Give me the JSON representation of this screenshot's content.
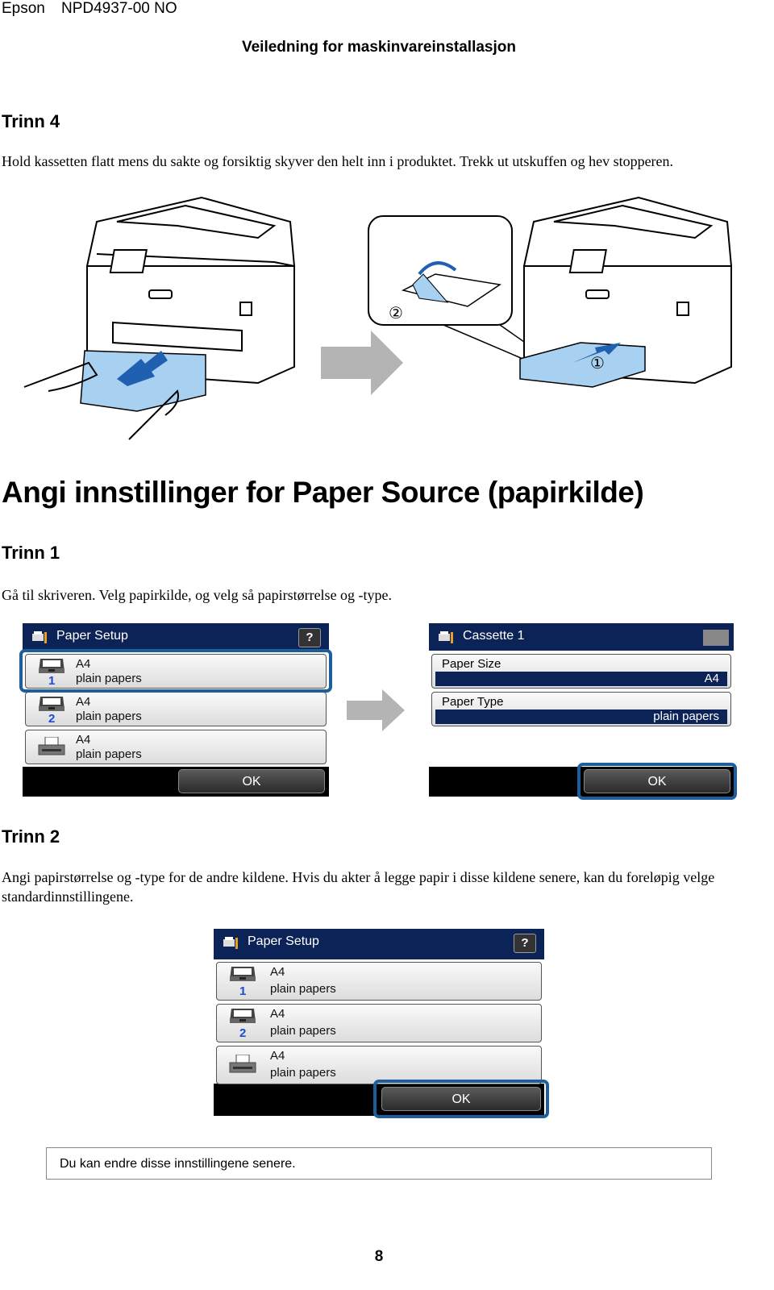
{
  "header": {
    "brand": "Epson",
    "doc_code": "NPD4937-00 NO",
    "title": "Veiledning for maskinvareinstallasjon"
  },
  "step4": {
    "heading": "Trinn 4",
    "text": "Hold kassetten flatt mens du sakte og forsiktig skyver den helt inn i produktet. Trekk ut utskuffen og hev stopperen.",
    "callouts": [
      "①",
      "②"
    ]
  },
  "section": {
    "title": "Angi innstillinger for Paper Source (papirkilde)"
  },
  "step1": {
    "heading": "Trinn 1",
    "text": "Gå til skriveren. Velg papirkilde, og velg så papirstørrelse og -type.",
    "paper_setup_panel": {
      "title": "Paper Setup",
      "help_label": "?",
      "sources": [
        {
          "number": "1",
          "size": "A4",
          "type": "plain papers",
          "selected": true
        },
        {
          "number": "2",
          "size": "A4",
          "type": "plain papers",
          "selected": false
        },
        {
          "number": "",
          "size": "A4",
          "type": "plain papers",
          "selected": false
        }
      ],
      "ok_label": "OK"
    },
    "cassette_panel": {
      "title": "Cassette 1",
      "fields": [
        {
          "label": "Paper Size",
          "value": "A4"
        },
        {
          "label": "Paper Type",
          "value": "plain papers"
        }
      ],
      "ok_label": "OK",
      "ok_selected": true
    }
  },
  "step2": {
    "heading": "Trinn 2",
    "text": "Angi papirstørrelse og -type for de andre kildene. Hvis du akter å legge papir i disse kildene senere, kan du foreløpig velge standardinnstillingene.",
    "paper_setup_panel": {
      "title": "Paper Setup",
      "help_label": "?",
      "sources": [
        {
          "number": "1",
          "size": "A4",
          "type": "plain papers"
        },
        {
          "number": "2",
          "size": "A4",
          "type": "plain papers"
        },
        {
          "number": "",
          "size": "A4",
          "type": "plain papers"
        }
      ],
      "ok_label": "OK",
      "ok_selected": true
    }
  },
  "note": {
    "text": "Du kan endre disse innstillingene senere."
  },
  "footer": {
    "page_number": "8"
  },
  "colors": {
    "lcd_header": "#0b2357",
    "selection_outline": "#1d5f9c",
    "tray_blue": "#a8d0f0",
    "arrow_gray": "#b4b4b4",
    "source_number": "#1a4bd6"
  }
}
